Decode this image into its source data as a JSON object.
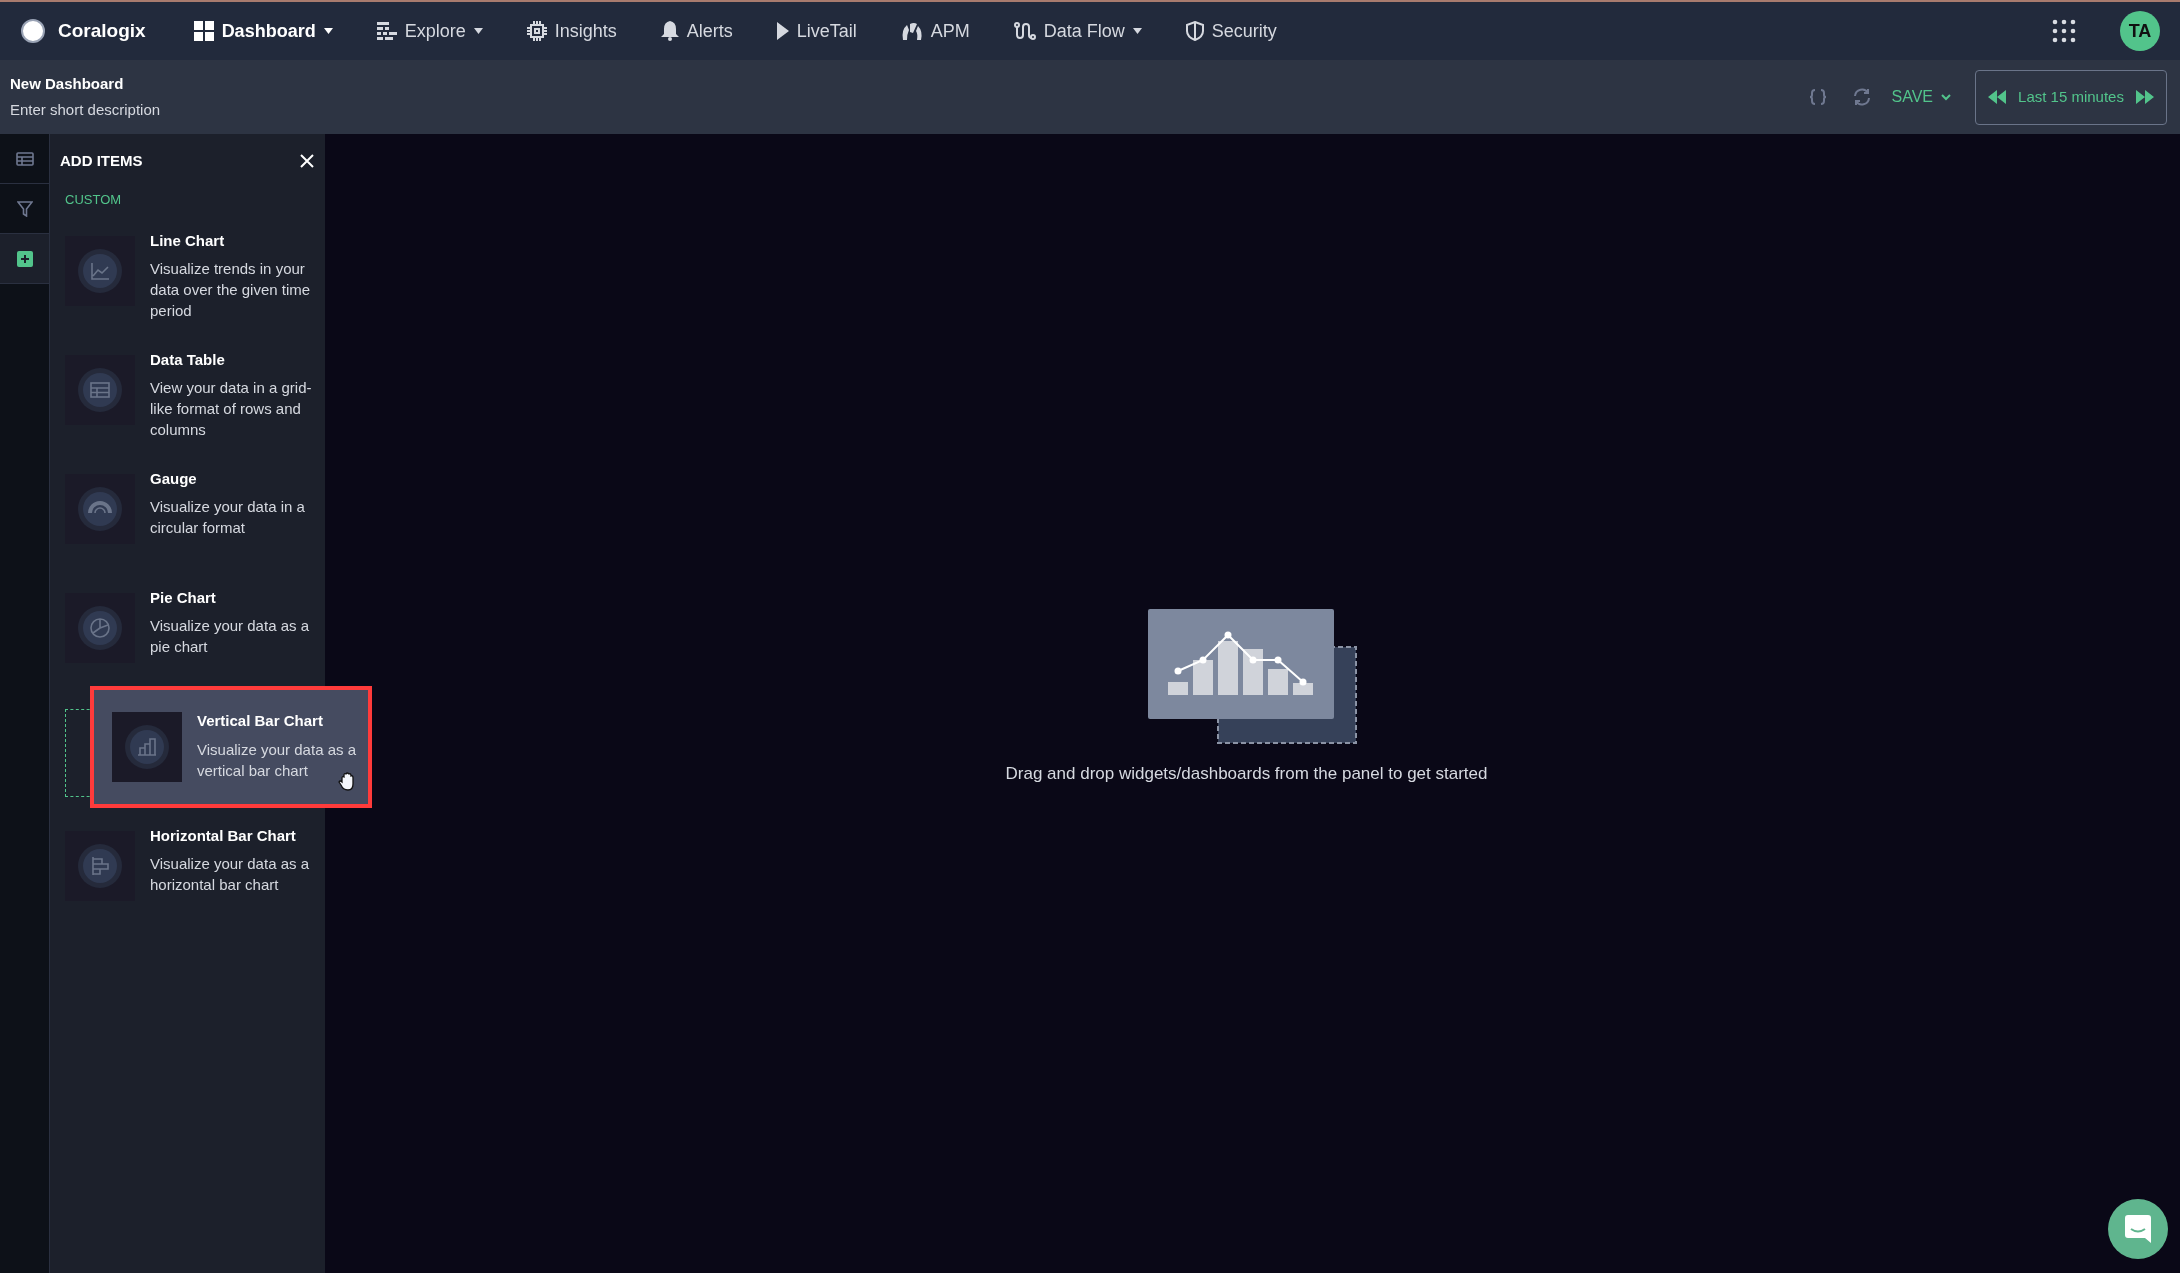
{
  "app": {
    "name": "Coralogix",
    "avatar": "TA"
  },
  "nav": [
    {
      "kind": "dashboard",
      "label": "Dashboard",
      "selected": true,
      "has_menu": true
    },
    {
      "kind": "explore",
      "label": "Explore",
      "selected": false,
      "has_menu": true
    },
    {
      "kind": "insights",
      "label": "Insights",
      "selected": false,
      "has_menu": false
    },
    {
      "kind": "alerts",
      "label": "Alerts",
      "selected": false,
      "has_menu": false
    },
    {
      "kind": "livetail",
      "label": "LiveTail",
      "selected": false,
      "has_menu": false
    },
    {
      "kind": "apm",
      "label": "APM",
      "selected": false,
      "has_menu": false
    },
    {
      "kind": "dataflow",
      "label": "Data Flow",
      "selected": false,
      "has_menu": true
    },
    {
      "kind": "security",
      "label": "Security",
      "selected": false,
      "has_menu": false
    }
  ],
  "header": {
    "title": "New Dashboard",
    "description": "Enter short description",
    "save": "SAVE",
    "time_range": "Last 15 minutes"
  },
  "rail": [
    {
      "kind": "table",
      "selected": false
    },
    {
      "kind": "filter",
      "selected": false
    },
    {
      "kind": "add",
      "selected": true
    }
  ],
  "panel": {
    "title": "ADD ITEMS",
    "section": "CUSTOM",
    "items": [
      {
        "kind": "line",
        "title": "Line Chart",
        "description": "Visualize trends in your data over the given time period",
        "dragging": false
      },
      {
        "kind": "table",
        "title": "Data Table",
        "description": "View your data in a grid-like format of rows and columns",
        "dragging": false
      },
      {
        "kind": "gauge",
        "title": "Gauge",
        "description": "Visualize your data in a circular format",
        "dragging": false
      },
      {
        "kind": "pie",
        "title": "Pie Chart",
        "description": "Visualize your data as a pie chart",
        "dragging": false
      },
      {
        "kind": "vbar",
        "title": "Vertical Bar Chart",
        "description": "Visualize your data as a vertical bar chart",
        "dragging": true
      },
      {
        "kind": "hbar",
        "title": "Horizontal Bar Chart",
        "description": "Visualize your data as a horizontal bar chart",
        "dragging": false
      }
    ]
  },
  "empty_state": {
    "message": "Drag and drop widgets/dashboards from the panel to get started"
  }
}
